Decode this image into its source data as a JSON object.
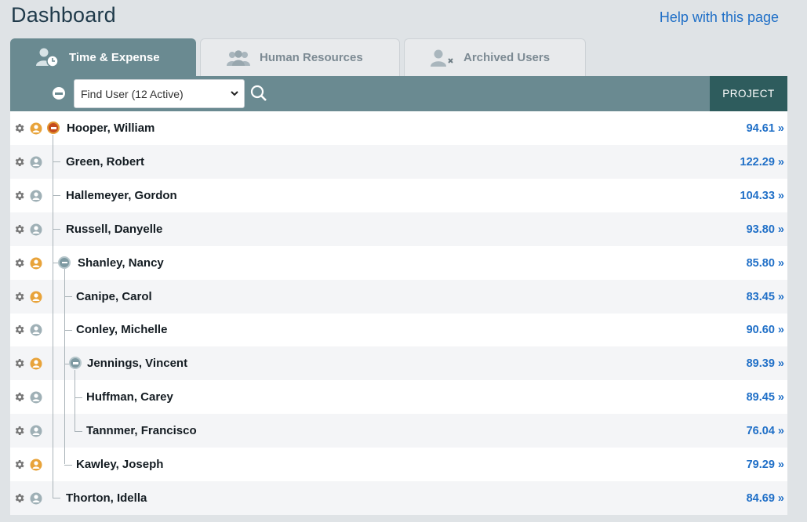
{
  "header": {
    "title": "Dashboard",
    "help_link": "Help with this page"
  },
  "tabs": [
    {
      "label": "Time & Expense",
      "icon": "user-clock-icon",
      "active": true
    },
    {
      "label": "Human Resources",
      "icon": "users-icon",
      "active": false
    },
    {
      "label": "Archived Users",
      "icon": "user-remove-icon",
      "active": false
    }
  ],
  "toolbar": {
    "find_user_value": "Find User (12 Active)",
    "project_label": "PROJECT"
  },
  "colors": {
    "accent": "#6a8a91",
    "project_header": "#2e5c5d",
    "link": "#1f6fc7",
    "manager_icon": "#e8a33a",
    "employee_icon": "#9fb0b6"
  },
  "users": [
    {
      "name": "Hooper, William",
      "value": "94.61 »",
      "manager": true,
      "level": 0,
      "expandable": true,
      "toggle_color": "red"
    },
    {
      "name": "Green, Robert",
      "value": "122.29 »",
      "manager": false,
      "level": 1
    },
    {
      "name": "Hallemeyer, Gordon",
      "value": "104.33 »",
      "manager": false,
      "level": 1
    },
    {
      "name": "Russell, Danyelle",
      "value": "93.80 »",
      "manager": false,
      "level": 1
    },
    {
      "name": "Shanley, Nancy",
      "value": "85.80 »",
      "manager": true,
      "level": 1,
      "expandable": true,
      "toggle_color": "gray"
    },
    {
      "name": "Canipe, Carol",
      "value": "83.45 »",
      "manager": true,
      "level": 2
    },
    {
      "name": "Conley, Michelle",
      "value": "90.60 »",
      "manager": false,
      "level": 2
    },
    {
      "name": "Jennings, Vincent",
      "value": "89.39 »",
      "manager": true,
      "level": 2,
      "expandable": true,
      "toggle_color": "gray"
    },
    {
      "name": "Huffman, Carey",
      "value": "89.45 »",
      "manager": false,
      "level": 3
    },
    {
      "name": "Tannmer, Francisco",
      "value": "76.04 »",
      "manager": false,
      "level": 3
    },
    {
      "name": "Kawley, Joseph",
      "value": "79.29 »",
      "manager": true,
      "level": 2
    },
    {
      "name": "Thorton, Idella",
      "value": "84.69 »",
      "manager": false,
      "level": 1
    }
  ]
}
